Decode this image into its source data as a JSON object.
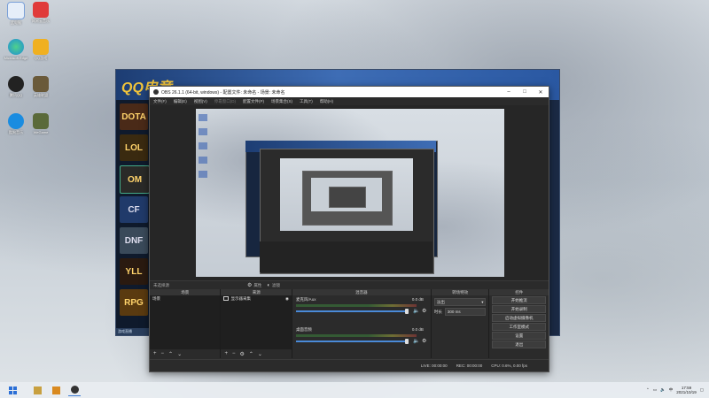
{
  "desktop": {
    "icons": [
      {
        "label": "此电脑",
        "color": "#4a7fd0",
        "icon": "computer-icon"
      },
      {
        "label": "网易云音乐",
        "color": "#e03a3a",
        "icon": "music-icon"
      },
      {
        "label": "Microsoft Edge",
        "color": "#1f8ed8",
        "icon": "edge-icon"
      },
      {
        "label": "QQ游戏",
        "color": "#f0b020",
        "icon": "qqgame-icon"
      },
      {
        "label": "腾讯QQ",
        "color": "#222222",
        "icon": "qq-icon"
      },
      {
        "label": "英雄联盟",
        "color": "#6a5a3a",
        "icon": "lol-icon"
      },
      {
        "label": "酷狗音乐",
        "color": "#1a8ce0",
        "icon": "kugou-icon"
      },
      {
        "label": "WeGame",
        "color": "#5a6a3a",
        "icon": "wegame-icon"
      }
    ]
  },
  "launcher": {
    "logo": "QQ电竞",
    "tiles": [
      "DOTA",
      "LOL",
      "OM",
      "CF",
      "DNF",
      "YLL",
      "RPG"
    ],
    "footer": "游戏直播"
  },
  "obs": {
    "title": "OBS 26.1.1 (64-bit, windows) - 配置文件: 未命名 - 场景: 未命名",
    "window_buttons": [
      "–",
      "□",
      "✕"
    ],
    "menu": [
      "文件(F)",
      "编辑(E)",
      "视图(V)",
      "停靠窗口(D)",
      "配置文件(P)",
      "场景集合(S)",
      "工具(T)",
      "帮助(H)"
    ],
    "toolbar": {
      "source_label": "未选择源",
      "props": "属性",
      "filters": "滤镜"
    },
    "docks": {
      "scenes": {
        "title": "场景",
        "items": [
          "场景"
        ]
      },
      "sources": {
        "title": "来源",
        "items": [
          "显示器采集"
        ]
      },
      "mixer": {
        "title": "混音器",
        "tracks": [
          {
            "name": "麦克风/Aux",
            "db": "0.0 dB"
          },
          {
            "name": "桌面音频",
            "db": "0.0 dB"
          }
        ]
      },
      "transitions": {
        "title": "转场特效",
        "type": "淡出",
        "duration_label": "时长",
        "duration": "300 ms"
      },
      "controls": {
        "title": "控件",
        "buttons": [
          "开始推流",
          "开始录制",
          "启动虚拟摄像机",
          "工作室模式",
          "设置",
          "退出"
        ]
      }
    },
    "status": {
      "live": "LIVE: 00:00:00",
      "rec": "REC: 00:00:00",
      "cpu": "CPU: 0.6%, 0.00 fps"
    }
  },
  "taskbar": {
    "time": "17:59",
    "date": "2021/10/19"
  }
}
